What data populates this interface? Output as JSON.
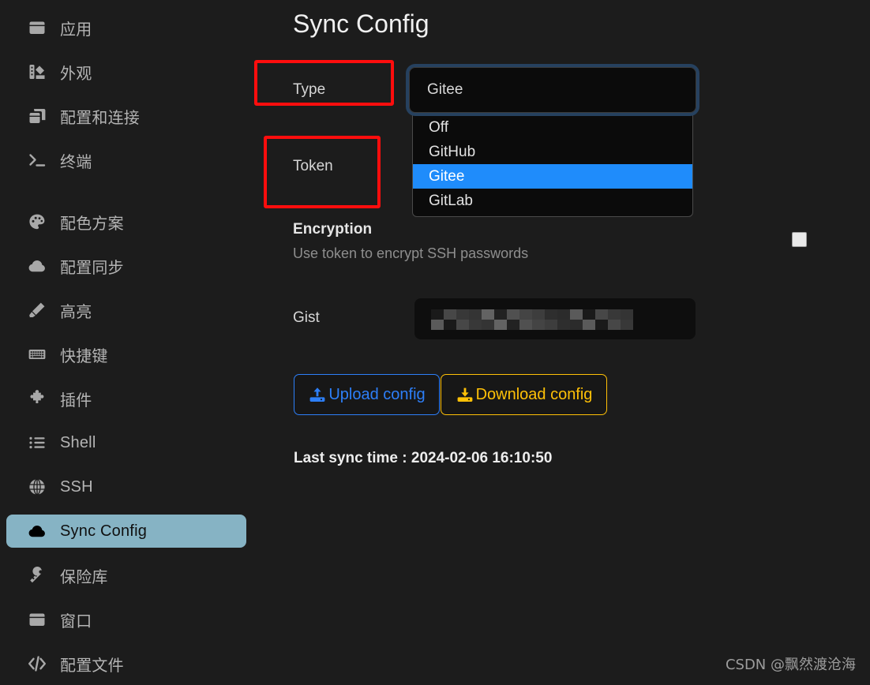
{
  "sidebar": {
    "items": [
      {
        "label": "应用",
        "icon": "window-icon",
        "selected": false,
        "gap_after": false
      },
      {
        "label": "外观",
        "icon": "palette-swatch-icon",
        "selected": false,
        "gap_after": false
      },
      {
        "label": "配置和连接",
        "icon": "copy-layers-icon",
        "selected": false,
        "gap_after": false
      },
      {
        "label": "终端",
        "icon": "terminal-icon",
        "selected": false,
        "gap_after": true
      },
      {
        "label": "配色方案",
        "icon": "palette-icon",
        "selected": false,
        "gap_after": false
      },
      {
        "label": "配置同步",
        "icon": "cloud-icon",
        "selected": false,
        "gap_after": false
      },
      {
        "label": "高亮",
        "icon": "highlighter-icon",
        "selected": false,
        "gap_after": false
      },
      {
        "label": "快捷键",
        "icon": "keyboard-icon",
        "selected": false,
        "gap_after": false
      },
      {
        "label": "插件",
        "icon": "puzzle-icon",
        "selected": false,
        "gap_after": false
      },
      {
        "label": "Shell",
        "icon": "list-icon",
        "selected": false,
        "gap_after": false
      },
      {
        "label": "SSH",
        "icon": "globe-icon",
        "selected": false,
        "gap_after": false
      },
      {
        "label": "Sync Config",
        "icon": "cloud-icon",
        "selected": true,
        "gap_after": false
      },
      {
        "label": "保险库",
        "icon": "key-icon",
        "selected": false,
        "gap_after": false
      },
      {
        "label": "窗口",
        "icon": "window-icon",
        "selected": false,
        "gap_after": false
      },
      {
        "label": "配置文件",
        "icon": "code-icon",
        "selected": false,
        "gap_after": false
      }
    ]
  },
  "main": {
    "title": "Sync Config",
    "type": {
      "label": "Type",
      "selected_value": "Gitee",
      "options": [
        "Off",
        "GitHub",
        "Gitee",
        "GitLab"
      ],
      "highlighted_option": "Gitee"
    },
    "token": {
      "label": "Token",
      "value": ""
    },
    "encryption": {
      "title": "Encryption",
      "description": "Use token to encrypt SSH passwords",
      "checked": false
    },
    "gist": {
      "label": "Gist",
      "value": "",
      "masked": true
    },
    "buttons": {
      "upload_label": "Upload config",
      "upload_icon": "upload-icon",
      "download_label": "Download config",
      "download_icon": "download-icon"
    },
    "last_sync": "Last sync time : 2024-02-06 16:10:50"
  },
  "annotations": {
    "box_color": "#ff0d0d",
    "boxes": [
      "Type",
      "Token"
    ]
  },
  "watermark": "CSDN @飘然渡沧海",
  "colors": {
    "background": "#1c1c1c",
    "sidebar_selected": "#86b3c4",
    "dropdown_highlight": "#1f8cfb",
    "upload_accent": "#2d7ff9",
    "download_accent": "#ffc107",
    "annotation_red": "#ff0d0d",
    "select_focus_ring": "#26415f"
  }
}
